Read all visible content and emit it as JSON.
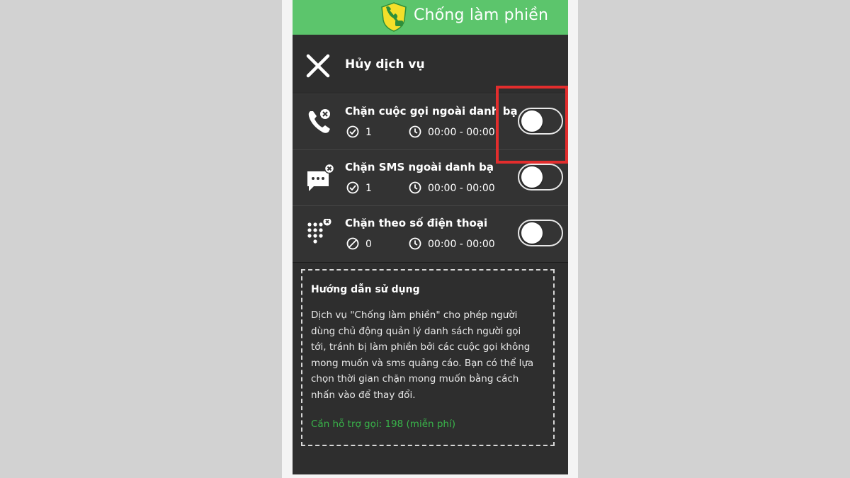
{
  "header": {
    "title": "Chống làm phiền"
  },
  "cancel": {
    "label": "Hủy dịch vụ"
  },
  "services": [
    {
      "title": "Chặn cuộc gọi ngoài danh bạ",
      "count": "1",
      "time": "00:00 - 00:00",
      "enabled": false
    },
    {
      "title": "Chặn SMS ngoài danh bạ",
      "count": "1",
      "time": "00:00 - 00:00",
      "enabled": false
    },
    {
      "title": "Chặn theo số điện thoại",
      "count": "0",
      "time": "00:00 - 00:00",
      "enabled": false
    }
  ],
  "guide": {
    "title": "Hướng dẫn sử dụng",
    "lines": [
      "Dịch vụ \"Chống làm phiền\" cho phép người",
      "dùng chủ động quản lý danh sách người gọi",
      "tới, tránh bị làm phiền bởi các cuộc gọi không",
      "mong muốn và sms quảng cáo. Bạn có thể lựa",
      "chọn thời gian chặn mong muốn bằng cách",
      "nhấn vào để thay đổi."
    ],
    "support": "Cần hỗ trợ gọi: 198 (miễn phí)"
  },
  "colors": {
    "header": "#5cc56c",
    "panel": "#2e2e2e",
    "highlight": "#e32d2d",
    "support_text": "#39b54a"
  }
}
